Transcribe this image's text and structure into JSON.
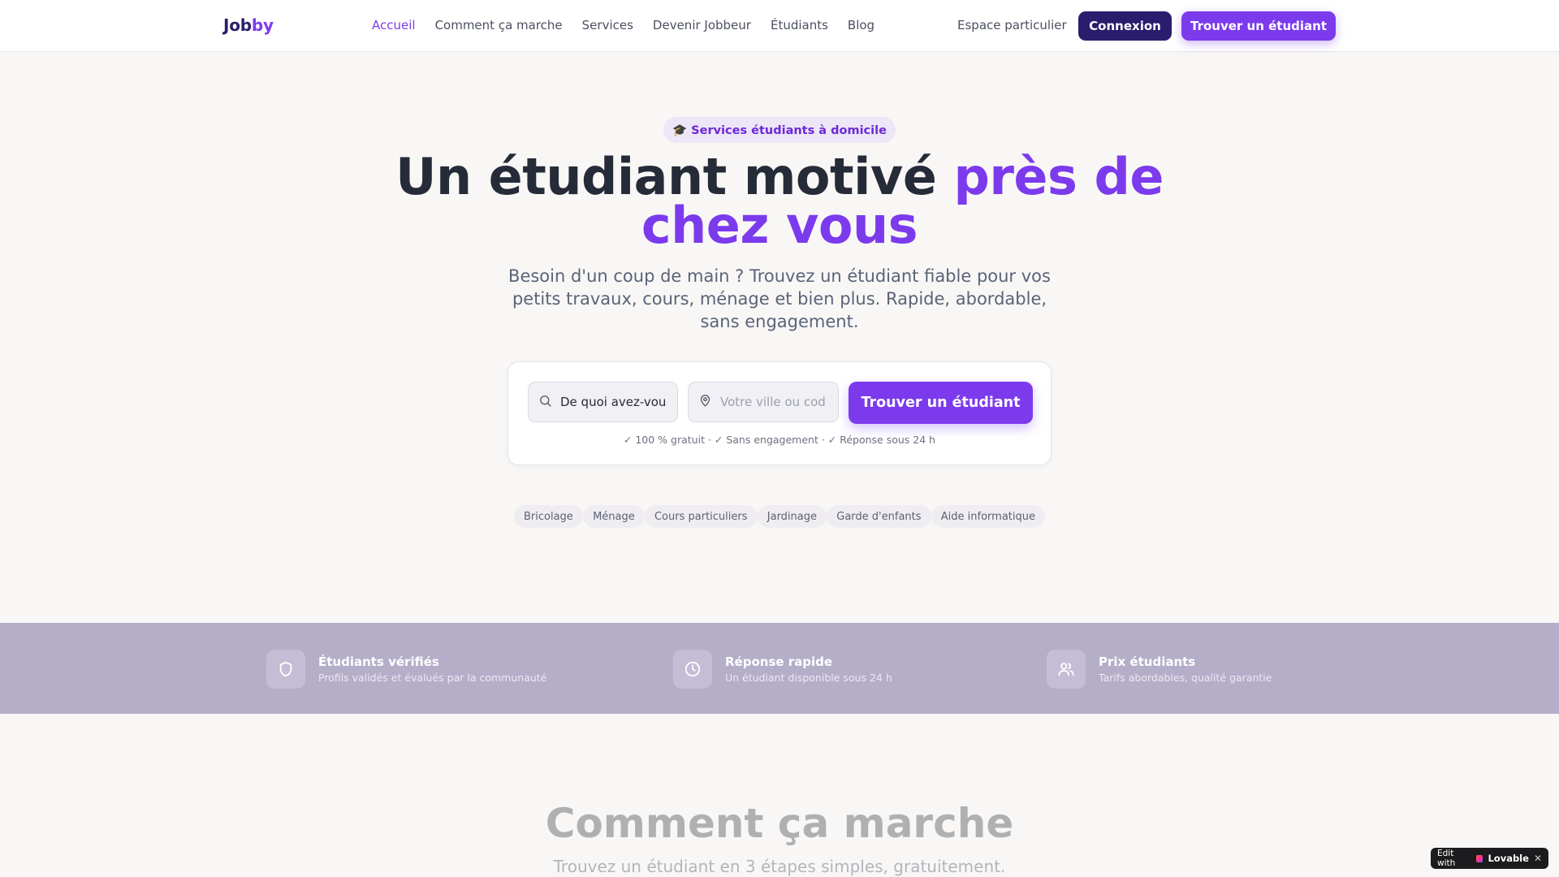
{
  "header": {
    "logo_part1": "Job",
    "logo_part2": "by",
    "nav": [
      "Accueil",
      "Comment ça marche",
      "Services",
      "Devenir Jobbeur",
      "Étudiants",
      "Blog"
    ],
    "active_nav": "Accueil",
    "espace": "Espace particulier",
    "login_label": "Connexion",
    "cta_label": "Trouver un étudiant"
  },
  "hero": {
    "badge_icon": "graduation-cap-icon",
    "badge": "🎓 Services étudiants à domicile",
    "title_part1": "Un étudiant motivé ",
    "title_part2": "près de chez vous",
    "subtitle": "Besoin d'un coup de main ? Trouvez un étudiant fiable pour vos petits travaux, cours, ménage et bien plus. Rapide, abordable, sans engagement."
  },
  "search": {
    "what_value": "De quoi avez-vous besoin ?",
    "what_icon": "search-icon",
    "where_placeholder": "Votre ville ou code postal",
    "where_icon": "map-pin-icon",
    "button": "Trouver un étudiant",
    "note": "✓ 100 % gratuit · ✓ Sans engagement · ✓ Réponse sous 24 h"
  },
  "categories": [
    "Bricolage",
    "Ménage",
    "Cours particuliers",
    "Jardinage",
    "Garde d'enfants",
    "Aide informatique"
  ],
  "features": [
    {
      "icon": "shield-icon",
      "title": "Étudiants vérifiés",
      "desc": "Profils validés et évalués par la communauté"
    },
    {
      "icon": "clock-icon",
      "title": "Réponse rapide",
      "desc": "Un étudiant disponible sous 24 h"
    },
    {
      "icon": "users-icon",
      "title": "Prix étudiants",
      "desc": "Tarifs abordables, qualité garantie"
    }
  ],
  "how": {
    "title": "Comment ça marche",
    "subtitle": "Trouvez un étudiant en 3 étapes simples, gratuitement."
  },
  "lovable": {
    "edit_with": "Edit with",
    "brand": "Lovable",
    "close": "✕"
  },
  "colors": {
    "brand": "#7c3aed",
    "dark_brand": "#2b1d6e",
    "band": "#b5aec9",
    "background": "#f8f7f6"
  }
}
